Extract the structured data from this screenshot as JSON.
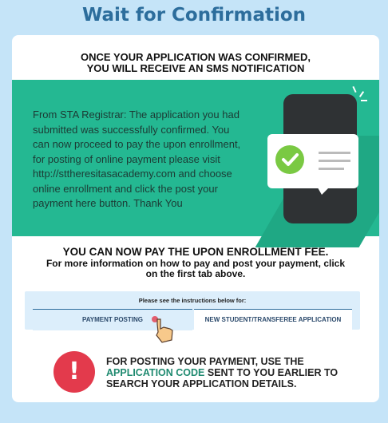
{
  "title": "Wait for Confirmation",
  "heading1": {
    "line1": "ONCE YOUR APPLICATION WAS CONFIRMED,",
    "line2": "YOU WILL RECEIVE AN SMS NOTIFICATION"
  },
  "sms": {
    "message": "From STA Registrar: The application you had submitted was successfully confirmed. You can now proceed to pay the upon enrollment, for posting of online payment please visit http://sttheresitasacademy.com and choose online enrollment and click the post your payment here button. Thank You"
  },
  "heading2": "YOU CAN NOW PAY THE UPON ENROLLMENT FEE.",
  "info": "For more information on how to pay and post your payment, click on the first tab above.",
  "instructions": {
    "label": "Please see the instructions below for:",
    "tabs": [
      {
        "label": "PAYMENT POSTING"
      },
      {
        "label": "NEW STUDENT/TRANSFEREE APPLICATION"
      }
    ]
  },
  "note": {
    "before": "FOR POSTING YOUR PAYMENT, USE THE",
    "code": "APPLICATION CODE",
    "after": "SENT TO YOU EARLIER TO SEARCH YOUR APPLICATION DETAILS."
  },
  "colors": {
    "background": "#c5e4f8",
    "title": "#2c6d9c",
    "banner": "#24b892",
    "alert": "#e33a4c",
    "check": "#7ac943",
    "code": "#1f8a70"
  },
  "icons": [
    "phone-icon",
    "check-icon",
    "pointing-hand-icon",
    "exclamation-icon"
  ]
}
